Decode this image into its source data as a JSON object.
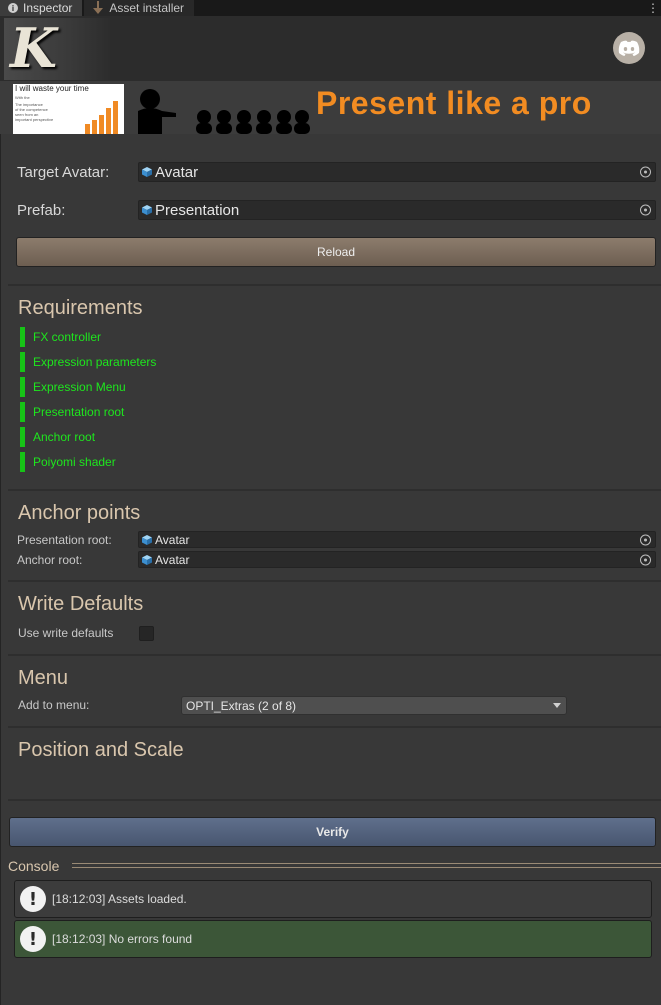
{
  "tabs": [
    {
      "label": "Inspector",
      "icon": "info-icon"
    },
    {
      "label": "Asset installer",
      "icon": "download-icon"
    }
  ],
  "banner": {
    "text": "Present like a pro",
    "slide_title": "I will waste your time",
    "slide_lines": [
      "With the",
      "The importance",
      "of the competence",
      "seen from an",
      "important perspective"
    ]
  },
  "fields": {
    "target_avatar": {
      "label": "Target Avatar:",
      "value": "Avatar"
    },
    "prefab": {
      "label": "Prefab:",
      "value": "Presentation"
    }
  },
  "reload_label": "Reload",
  "requirements": {
    "title": "Requirements",
    "items": [
      "FX controller",
      "Expression parameters",
      "Expression Menu",
      "Presentation root",
      "Anchor root",
      "Poiyomi shader"
    ],
    "status_color": "#17c317"
  },
  "anchor_points": {
    "title": "Anchor points",
    "presentation_root": {
      "label": "Presentation root:",
      "value": "Avatar"
    },
    "anchor_root": {
      "label": "Anchor root:",
      "value": "Avatar"
    }
  },
  "write_defaults": {
    "title": "Write Defaults",
    "label": "Use write defaults",
    "checked": false
  },
  "menu": {
    "title": "Menu",
    "label": "Add to menu:",
    "selected": "OPTI_Extras (2 of 8)"
  },
  "position_scale": {
    "title": "Position and Scale"
  },
  "verify_label": "Verify",
  "console": {
    "title": "Console",
    "logs": [
      {
        "text": "[18:12:03] Assets loaded.",
        "level": "info"
      },
      {
        "text": "[18:12:03] No errors found",
        "level": "success"
      }
    ]
  },
  "colors": {
    "accent_title": "#d9c6ad",
    "reload_button": "#7d6d5f",
    "verify_button": "#56647e",
    "success_log": "#3c5638",
    "banner_text": "#f28c22"
  }
}
